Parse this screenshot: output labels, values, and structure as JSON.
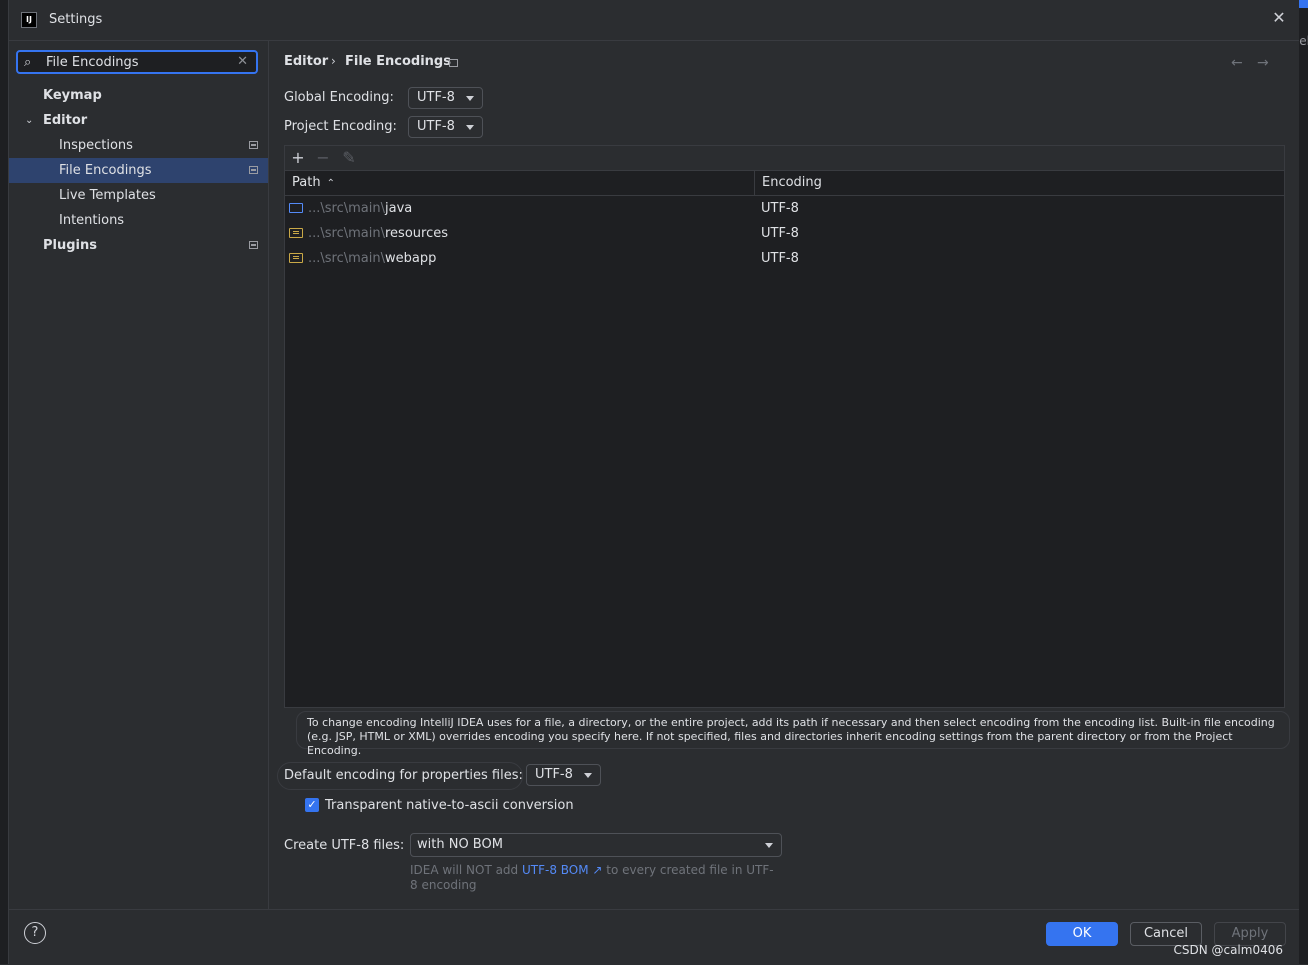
{
  "window": {
    "title": "Settings",
    "app_icon": "IJ"
  },
  "search": {
    "value": "File Encodings"
  },
  "sidebar": {
    "items": [
      {
        "label": "Keymap"
      },
      {
        "label": "Editor"
      },
      {
        "label": "Inspections"
      },
      {
        "label": "File Encodings"
      },
      {
        "label": "Live Templates"
      },
      {
        "label": "Intentions"
      },
      {
        "label": "Plugins"
      }
    ]
  },
  "breadcrumb": {
    "parent": "Editor",
    "separator": "›",
    "current": "File Encodings"
  },
  "global_encoding": {
    "label": "Global Encoding:",
    "value": "UTF-8"
  },
  "project_encoding": {
    "label": "Project Encoding:",
    "value": "UTF-8"
  },
  "table": {
    "headers": {
      "path": "Path",
      "encoding": "Encoding"
    },
    "rows": [
      {
        "dim": "...\\src\\main\\",
        "name": "java",
        "encoding": "UTF-8"
      },
      {
        "dim": "...\\src\\main\\",
        "name": "resources",
        "encoding": "UTF-8"
      },
      {
        "dim": "...\\src\\main\\",
        "name": "webapp",
        "encoding": "UTF-8"
      }
    ]
  },
  "info_text": "To change encoding IntelliJ IDEA uses for a file, a directory, or the entire project, add its path if necessary and then select encoding from the encoding list. Built-in file encoding (e.g. JSP, HTML or XML) overrides encoding you specify here. If not specified, files and directories inherit encoding settings from the parent directory or from the Project Encoding.",
  "properties_encoding": {
    "label": "Default encoding for properties files:",
    "value": "UTF-8"
  },
  "native_to_ascii": {
    "label": "Transparent native-to-ascii conversion",
    "checked": true
  },
  "create_utf8": {
    "label": "Create UTF-8 files:",
    "value": "with NO BOM",
    "hint_before": "IDEA will NOT add ",
    "hint_link": "UTF-8 BOM",
    "hint_after": " to every created file in UTF-8 encoding"
  },
  "footer": {
    "ok": "OK",
    "cancel": "Cancel",
    "apply": "Apply",
    "help": "?"
  },
  "watermark": "CSDN @calm0406",
  "background_fragment": "el",
  "colors": {
    "accent": "#3574f0",
    "selection": "#2e436e",
    "bg": "#2b2d30",
    "table_bg": "#1e1f22"
  }
}
